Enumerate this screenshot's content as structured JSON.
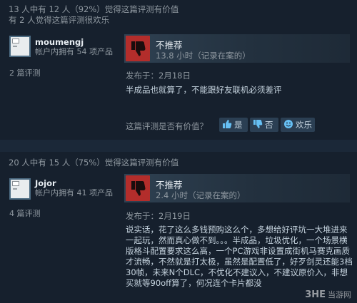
{
  "reviews": [
    {
      "helpful_summary": "13 人中有 12 人（92%）觉得这篇评测有价值",
      "funny_summary": "有 2 人觉得这篇评测很欢乐",
      "author": "moumengj",
      "products_owned": "帐户内拥有 54 项产品",
      "review_count": "2 篇评测",
      "verdict": "不推荐",
      "hours": "13.8 小时（记录在案的）",
      "posted": "发布于：2月18日",
      "text": "半成品也就算了，不能跟好友联机必须差评",
      "helpful_prompt": "这篇评测是否有价值？",
      "buttons": {
        "yes": "是",
        "no": "否",
        "funny": "欢乐"
      }
    },
    {
      "helpful_summary": "20 人中有 15 人（75%）觉得这篇评测有价值",
      "author": "Jojor",
      "products_owned": "帐户内拥有 41 项产品",
      "review_count": "4 篇评测",
      "verdict": "不推荐",
      "hours": "2.4 小时（记录在案的）",
      "posted": "发布于：2月19日",
      "text": "说实话，花了这么多钱预购这么个，多想给好评坑一大堆进来一起玩，然而真心做不到。。。半成品，垃圾优化，一个场景横版格斗配置要求这么高，一个PC游戏非设置成街机马赛克画质才流畅，不然就是打太极，虽然是配置低了，好歹剑灵还能3档30帧，未来N个DLC，不优化不建议入，不建议原价入，非想买就等90off算了，何况连个卡片都没"
    }
  ],
  "watermark": {
    "brand": "3HE",
    "site": "当游网"
  },
  "colors": {
    "background": "#1b2838",
    "panel": "#16202d",
    "thumb_down": "#b32d2b",
    "button": "#2b3f53"
  },
  "icons": {
    "verdict": "thumbs-down-icon",
    "yes": "thumbs-up-icon",
    "no": "thumbs-down-icon",
    "funny": "smiley-icon"
  }
}
